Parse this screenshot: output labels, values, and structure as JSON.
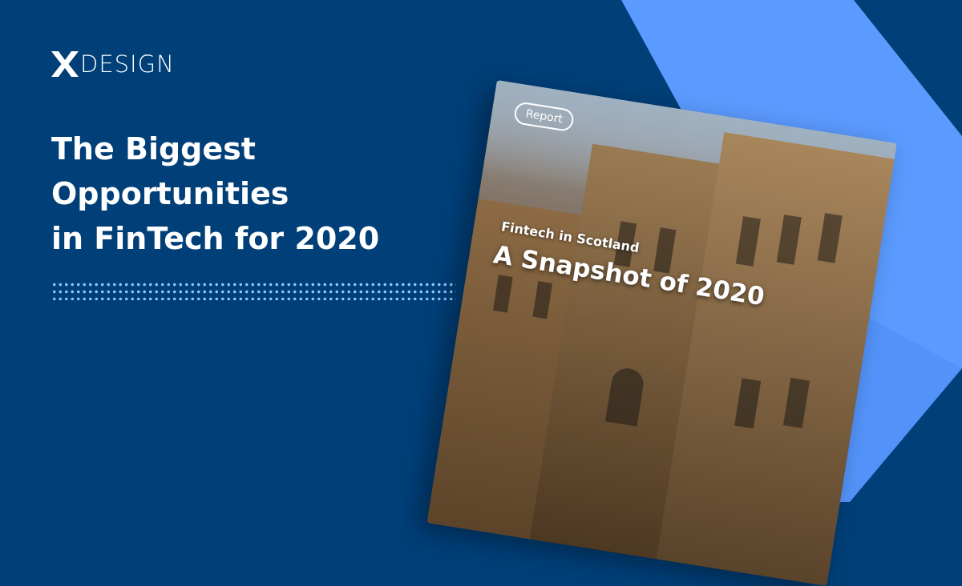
{
  "brand": {
    "logo_text": "DESIGN",
    "logo_mark": "x-logo-mark"
  },
  "headline": {
    "line1": "The Biggest",
    "line2": "Opportunities",
    "line3": "in FinTech for 2020"
  },
  "report": {
    "badge": "Report",
    "subtitle": "Fintech in Scotland",
    "title": "A Snapshot of 2020"
  },
  "colors": {
    "background": "#003f78",
    "accent": "#5b9bff",
    "dots": "#8fc4ff",
    "text": "#ffffff"
  }
}
